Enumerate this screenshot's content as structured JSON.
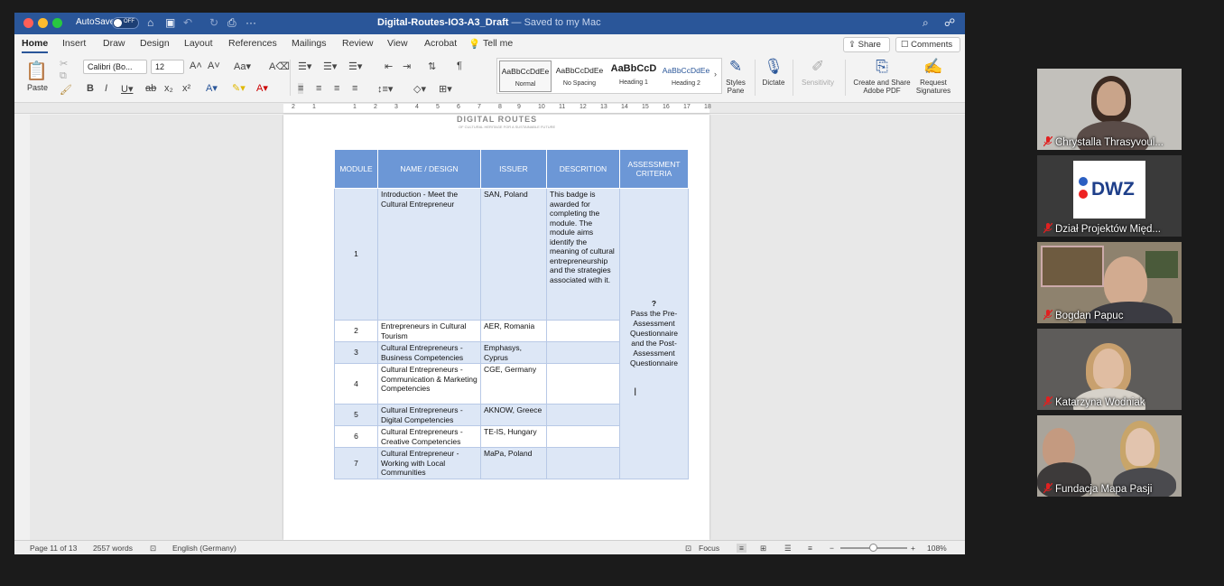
{
  "word": {
    "autosave_label": "AutoSave",
    "autosave_state": "OFF",
    "doc_title": "Digital-Routes-IO3-A3_Draft",
    "saved_status": "— Saved to my Mac",
    "tabs": [
      "Home",
      "Insert",
      "Draw",
      "Design",
      "Layout",
      "References",
      "Mailings",
      "Review",
      "View",
      "Acrobat"
    ],
    "tell_me": "Tell me",
    "share_label": "Share",
    "comments_label": "Comments",
    "ribbon": {
      "paste_label": "Paste",
      "font_name": "Calibri (Bo...",
      "font_size": "12",
      "styles": [
        {
          "sample": "AaBbCcDdEe",
          "name": "Normal"
        },
        {
          "sample": "AaBbCcDdEe",
          "name": "No Spacing"
        },
        {
          "sample": "AaBbCcD",
          "name": "Heading 1"
        },
        {
          "sample": "AaBbCcDdEe",
          "name": "Heading 2"
        }
      ],
      "styles_pane_label": "Styles\nPane",
      "dictate_label": "Dictate",
      "sensitivity_label": "Sensitivity",
      "create_pdf_label": "Create and Share\nAdobe PDF",
      "request_sig_label": "Request\nSignatures"
    },
    "ruler_numbers": [
      "2",
      "1",
      "1",
      "2",
      "3",
      "4",
      "5",
      "6",
      "7",
      "8",
      "9",
      "10",
      "11",
      "12",
      "13",
      "14",
      "15",
      "16",
      "17",
      "18"
    ],
    "page_header": {
      "logo_text": "DIGITAL ROUTES",
      "logo_sub": "OF CULTURAL HERITAGE FOR A SUSTAINABLE FUTURE"
    },
    "table": {
      "headers": [
        "MODULE",
        "NAME / DESIGN",
        "ISSUER",
        "DESCRITION",
        "ASSESSMENT CRITERIA"
      ],
      "rows": [
        {
          "module": "1",
          "name": "Introduction - Meet the Cultural Entrepreneur",
          "issuer": "SAN, Poland",
          "description": "This badge is awarded for completing the module. The module aims identify the meaning of cultural entrepreneurship and the strategies associated with it."
        },
        {
          "module": "2",
          "name": "Entrepreneurs in Cultural Tourism",
          "issuer": "AER, Romania",
          "description": ""
        },
        {
          "module": "3",
          "name": "Cultural Entrepreneurs - Business Competencies",
          "issuer": "Emphasys, Cyprus",
          "description": ""
        },
        {
          "module": "4",
          "name": "Cultural Entrepreneurs - Communication & Marketing Competencies",
          "issuer": "CGE, Germany",
          "description": ""
        },
        {
          "module": "5",
          "name": "Cultural Entrepreneurs - Digital Competencies",
          "issuer": "AKNOW, Greece",
          "description": ""
        },
        {
          "module": "6",
          "name": "Cultural Entrepreneurs - Creative Competencies",
          "issuer": "TE-IS, Hungary",
          "description": ""
        },
        {
          "module": "7",
          "name": "Cultural Entrepreneur - Working with Local Communities",
          "issuer": "MaPa, Poland",
          "description": ""
        }
      ],
      "criteria_mark": "?",
      "criteria": "Pass the Pre-Assessment Questionnaire and the Post-Assessment Questionnaire"
    },
    "status": {
      "page": "Page 11 of 13",
      "words": "2557 words",
      "language": "English (Germany)",
      "focus": "Focus",
      "zoom": "108%"
    }
  },
  "participants": [
    {
      "name": "Chrystalla Thrasyvoul...",
      "bg": "#bdbcb6"
    },
    {
      "name": "Dział Projektów Międ...",
      "bg": "#3a3a3a",
      "logo": "DWZ"
    },
    {
      "name": "Bogdan Papuc",
      "bg": "#8a7a64"
    },
    {
      "name": "Katarzyna Wodniak",
      "bg": "#6a6866"
    },
    {
      "name": "Fundacja Mapa Pasji",
      "bg": "#a7a29a"
    }
  ]
}
